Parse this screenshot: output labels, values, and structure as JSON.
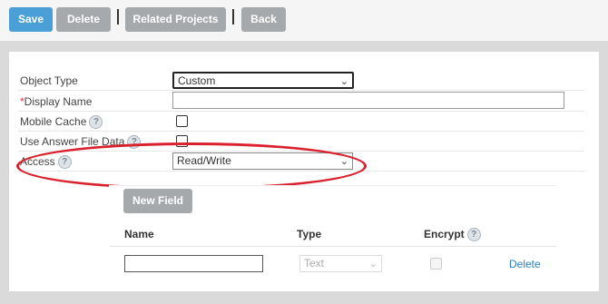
{
  "toolbar": {
    "save_label": "Save",
    "delete_label": "Delete",
    "related_projects_label": "Related Projects",
    "back_label": "Back"
  },
  "form": {
    "object_type": {
      "label": "Object Type",
      "value": "Custom"
    },
    "display_name": {
      "required_mark": "*",
      "label": "Display Name",
      "value": ""
    },
    "mobile_cache": {
      "label": "Mobile Cache",
      "checked": false
    },
    "use_answer_file_data": {
      "label": "Use Answer File Data",
      "checked": false
    },
    "access": {
      "label": "Access",
      "value": "Read/Write"
    },
    "help_glyph": "?"
  },
  "fields_section": {
    "new_field_label": "New Field",
    "columns": {
      "name": "Name",
      "type": "Type",
      "encrypt": "Encrypt"
    },
    "rows": [
      {
        "name": "",
        "type": "Text",
        "encrypt": false,
        "action": "Delete"
      }
    ]
  },
  "colors": {
    "primary": "#4a9fd6",
    "secondary": "#a6a9ab",
    "highlight": "#d9202c",
    "link": "#2f7fc1"
  }
}
